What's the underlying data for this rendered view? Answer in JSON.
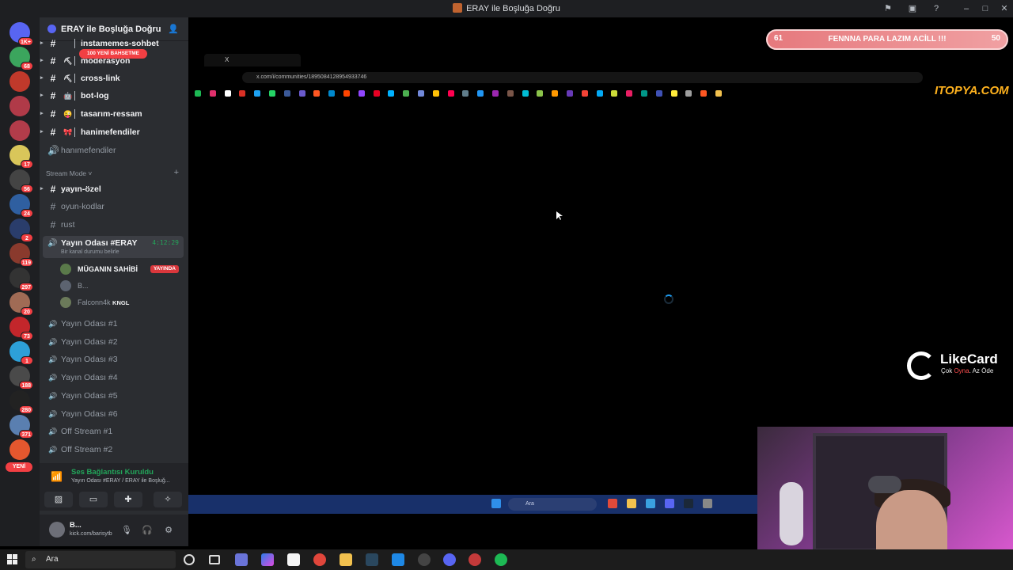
{
  "window": {
    "title": "ERAY ile Boşluğa Doğru"
  },
  "rail": {
    "servers": [
      {
        "badge": "1K+",
        "color": "#5865f2"
      },
      {
        "badge": "68",
        "color": "#3ba55d"
      },
      {
        "badge": "",
        "color": "#c0392b"
      },
      {
        "badge": "",
        "color": "#b03a48"
      },
      {
        "badge": "",
        "color": "#b23c4a"
      },
      {
        "badge": "17",
        "color": "#d9c65a"
      },
      {
        "badge": "56",
        "color": "#444"
      },
      {
        "badge": "24",
        "color": "#2f5fa0"
      },
      {
        "badge": "2",
        "color": "#2a3d6b"
      },
      {
        "badge": "119",
        "color": "#8a3a2d"
      },
      {
        "badge": "297",
        "color": "#333"
      },
      {
        "badge": "20",
        "color": "#a06b55"
      },
      {
        "badge": "73",
        "color": "#c3262b"
      },
      {
        "badge": "1",
        "color": "#2da0d8"
      },
      {
        "badge": "188",
        "color": "#4a4a4a"
      },
      {
        "badge": "280",
        "color": "#222"
      },
      {
        "badge": "371",
        "color": "#5a7fb0"
      },
      {
        "badge": "",
        "color": "#e4572e"
      }
    ],
    "new_label": "YENİ"
  },
  "server": {
    "name": "ERAY ile Boşluğa Doğru"
  },
  "channels_top": [
    {
      "emoji": "",
      "label": "instamemes-sohbet",
      "unread": true
    },
    {
      "emoji": "⛏",
      "label": "moderasyon",
      "unread": true
    },
    {
      "emoji": "⛏",
      "label": "cross-link",
      "unread": true
    },
    {
      "emoji": "🤖",
      "label": "bot-log",
      "unread": true
    },
    {
      "emoji": "😜",
      "label": "tasarım-ressam",
      "unread": true
    },
    {
      "emoji": "🎀",
      "label": "hanimefendiler",
      "unread": true
    }
  ],
  "mention_pill": "100 YENİ BAHSETME",
  "voice_hanimefendiler": "hanımefendiler",
  "category": {
    "name": "Stream Mode"
  },
  "stream_channels": [
    {
      "label": "yayın-özel",
      "unread": true
    },
    {
      "label": "oyun-kodlar",
      "unread": false
    },
    {
      "label": "rust",
      "unread": false
    }
  ],
  "active_voice": {
    "name": "Yayın Odası #ERAY",
    "status": "Bir kanal durumu belirle",
    "time": "4:12:29",
    "users": [
      {
        "name": "MÜGANIN SAHİBİ",
        "live": "YAYINDA"
      },
      {
        "name": "B...",
        "live": ""
      },
      {
        "name": "Falconn4k",
        "tag": "KNGL"
      }
    ]
  },
  "voice_channels": [
    "Yayın Odası #1",
    "Yayın Odası #2",
    "Yayın Odası #3",
    "Yayın Odası #4",
    "Yayın Odası #5",
    "Yayın Odası #6",
    "Off Stream #1",
    "Off Stream #2"
  ],
  "voice_panel": {
    "connected": "Ses Bağlantısı Kuruldu",
    "location": "Yayın Odası #ERAY / ERAY ile Boşluğ..."
  },
  "user_panel": {
    "name": "B...",
    "status": "kick.com/barisytb"
  },
  "stream": {
    "goal": {
      "left": "61",
      "text": "FENNNA PARA LAZIM ACİLL !!!",
      "right": "50"
    },
    "tab_title": "X",
    "url": "x.com/i/communities/1895084128954933746",
    "likecard": {
      "name": "LikeCard",
      "tag_pre": "Çok ",
      "tag_mid": "Oyna",
      "tag_post": ". Az Öde"
    },
    "itopya": "ITOPYA.COM",
    "inner_search": "Ara"
  },
  "taskbar": {
    "search": "Ara"
  },
  "colors": {
    "discord_bg": "#2b2d31",
    "rail_bg": "#1e1f22",
    "green": "#23a55a",
    "red": "#f23f43"
  }
}
